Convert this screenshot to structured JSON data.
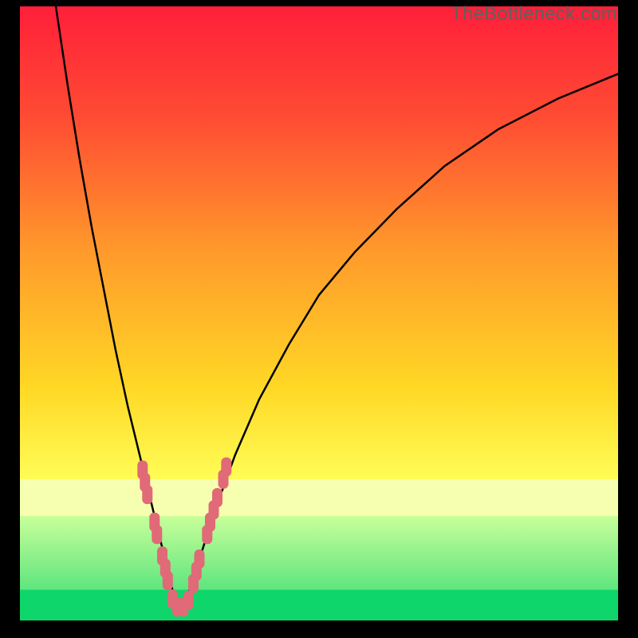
{
  "watermark": "TheBottleneck.com",
  "colors": {
    "bg_black": "#000000",
    "grad_top": "#ff1f3a",
    "grad_mid1": "#ff7a2e",
    "grad_mid2": "#ffd825",
    "grad_yellow": "#ffff5a",
    "grad_pale": "#f6ffb0",
    "grad_green": "#0fd66a",
    "curve": "#000000",
    "marker_fill": "#e06a77",
    "marker_stroke": "#e06a77"
  },
  "chart_data": {
    "type": "line",
    "title": "",
    "xlabel": "",
    "ylabel": "",
    "xlim": [
      0,
      100
    ],
    "ylim": [
      0,
      100
    ],
    "grid": false,
    "legend": false,
    "series": [
      {
        "name": "left-branch",
        "x": [
          6,
          8,
          10,
          12,
          14,
          16,
          18,
          19,
          20,
          21,
          22,
          23,
          24,
          25,
          26
        ],
        "y": [
          100,
          87,
          75,
          64,
          54,
          44,
          35,
          31,
          27,
          23,
          19,
          15,
          11,
          7,
          3
        ]
      },
      {
        "name": "right-branch",
        "x": [
          27,
          28,
          29,
          30,
          31,
          33,
          36,
          40,
          45,
          50,
          56,
          63,
          71,
          80,
          90,
          100
        ],
        "y": [
          2,
          4,
          7,
          10,
          13,
          19,
          27,
          36,
          45,
          53,
          60,
          67,
          74,
          80,
          85,
          89
        ]
      }
    ],
    "markers": [
      {
        "x": 20.5,
        "y": 24.5
      },
      {
        "x": 20.9,
        "y": 22.5
      },
      {
        "x": 21.3,
        "y": 20.5
      },
      {
        "x": 22.5,
        "y": 16.0
      },
      {
        "x": 22.9,
        "y": 14.0
      },
      {
        "x": 23.8,
        "y": 10.5
      },
      {
        "x": 24.3,
        "y": 8.5
      },
      {
        "x": 24.7,
        "y": 6.5
      },
      {
        "x": 25.5,
        "y": 3.5
      },
      {
        "x": 26.3,
        "y": 2.2
      },
      {
        "x": 27.3,
        "y": 2.2
      },
      {
        "x": 28.2,
        "y": 3.3
      },
      {
        "x": 29.0,
        "y": 6.0
      },
      {
        "x": 29.5,
        "y": 8.0
      },
      {
        "x": 30.0,
        "y": 10.0
      },
      {
        "x": 31.3,
        "y": 14.0
      },
      {
        "x": 31.8,
        "y": 16.0
      },
      {
        "x": 32.4,
        "y": 18.0
      },
      {
        "x": 33.0,
        "y": 20.0
      },
      {
        "x": 34.0,
        "y": 23.0
      },
      {
        "x": 34.5,
        "y": 25.0
      }
    ],
    "bands": [
      {
        "name": "pale",
        "y0": 17,
        "y1": 23,
        "color": "#f6ffb0"
      },
      {
        "name": "lightgreen",
        "y0": 5,
        "y1": 17,
        "color_top": "#c8ff9a",
        "color_bot": "#5fe57e"
      },
      {
        "name": "green",
        "y0": 0,
        "y1": 5,
        "color": "#0fd66a"
      }
    ]
  }
}
